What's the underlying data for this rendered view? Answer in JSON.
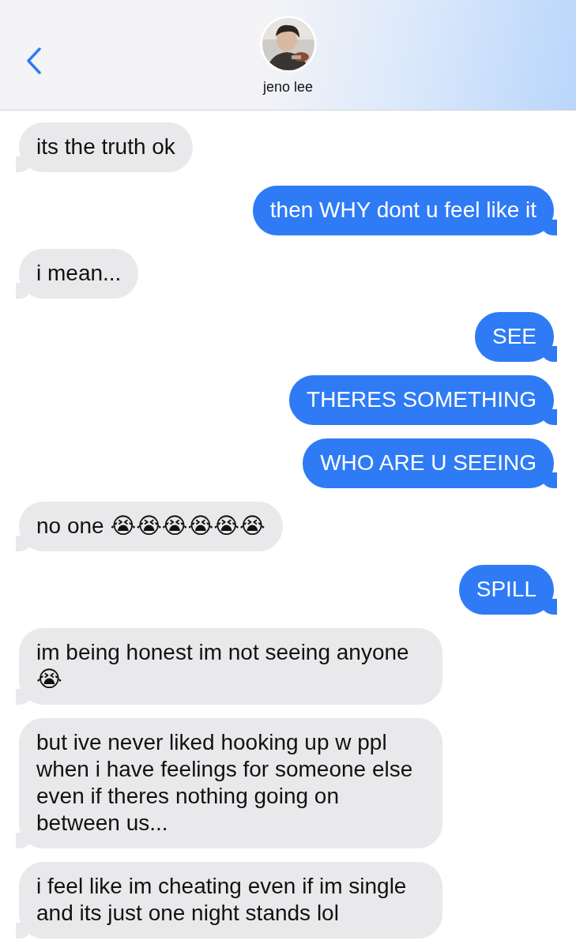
{
  "header": {
    "contact_name": "jeno lee"
  },
  "messages": [
    {
      "kind": "incoming",
      "text": "its the truth ok"
    },
    {
      "kind": "outgoing",
      "text": "then WHY dont u feel like it"
    },
    {
      "kind": "incoming",
      "text": "i mean..."
    },
    {
      "kind": "outgoing",
      "text": "SEE"
    },
    {
      "kind": "outgoing",
      "text": "THERES SOMETHING"
    },
    {
      "kind": "outgoing",
      "text": "WHO ARE U SEEING"
    },
    {
      "kind": "incoming",
      "text": "no one 😭😭😭😭😭😭"
    },
    {
      "kind": "outgoing",
      "text": "SPILL"
    },
    {
      "kind": "incoming",
      "text": "im being honest im not seeing anyone 😭"
    },
    {
      "kind": "incoming",
      "text": "but ive never liked hooking up w ppl when i have feelings for someone else even if theres nothing going on between us..."
    },
    {
      "kind": "incoming",
      "text": "i feel like im cheating even if im single and its just one night stands lol"
    }
  ]
}
